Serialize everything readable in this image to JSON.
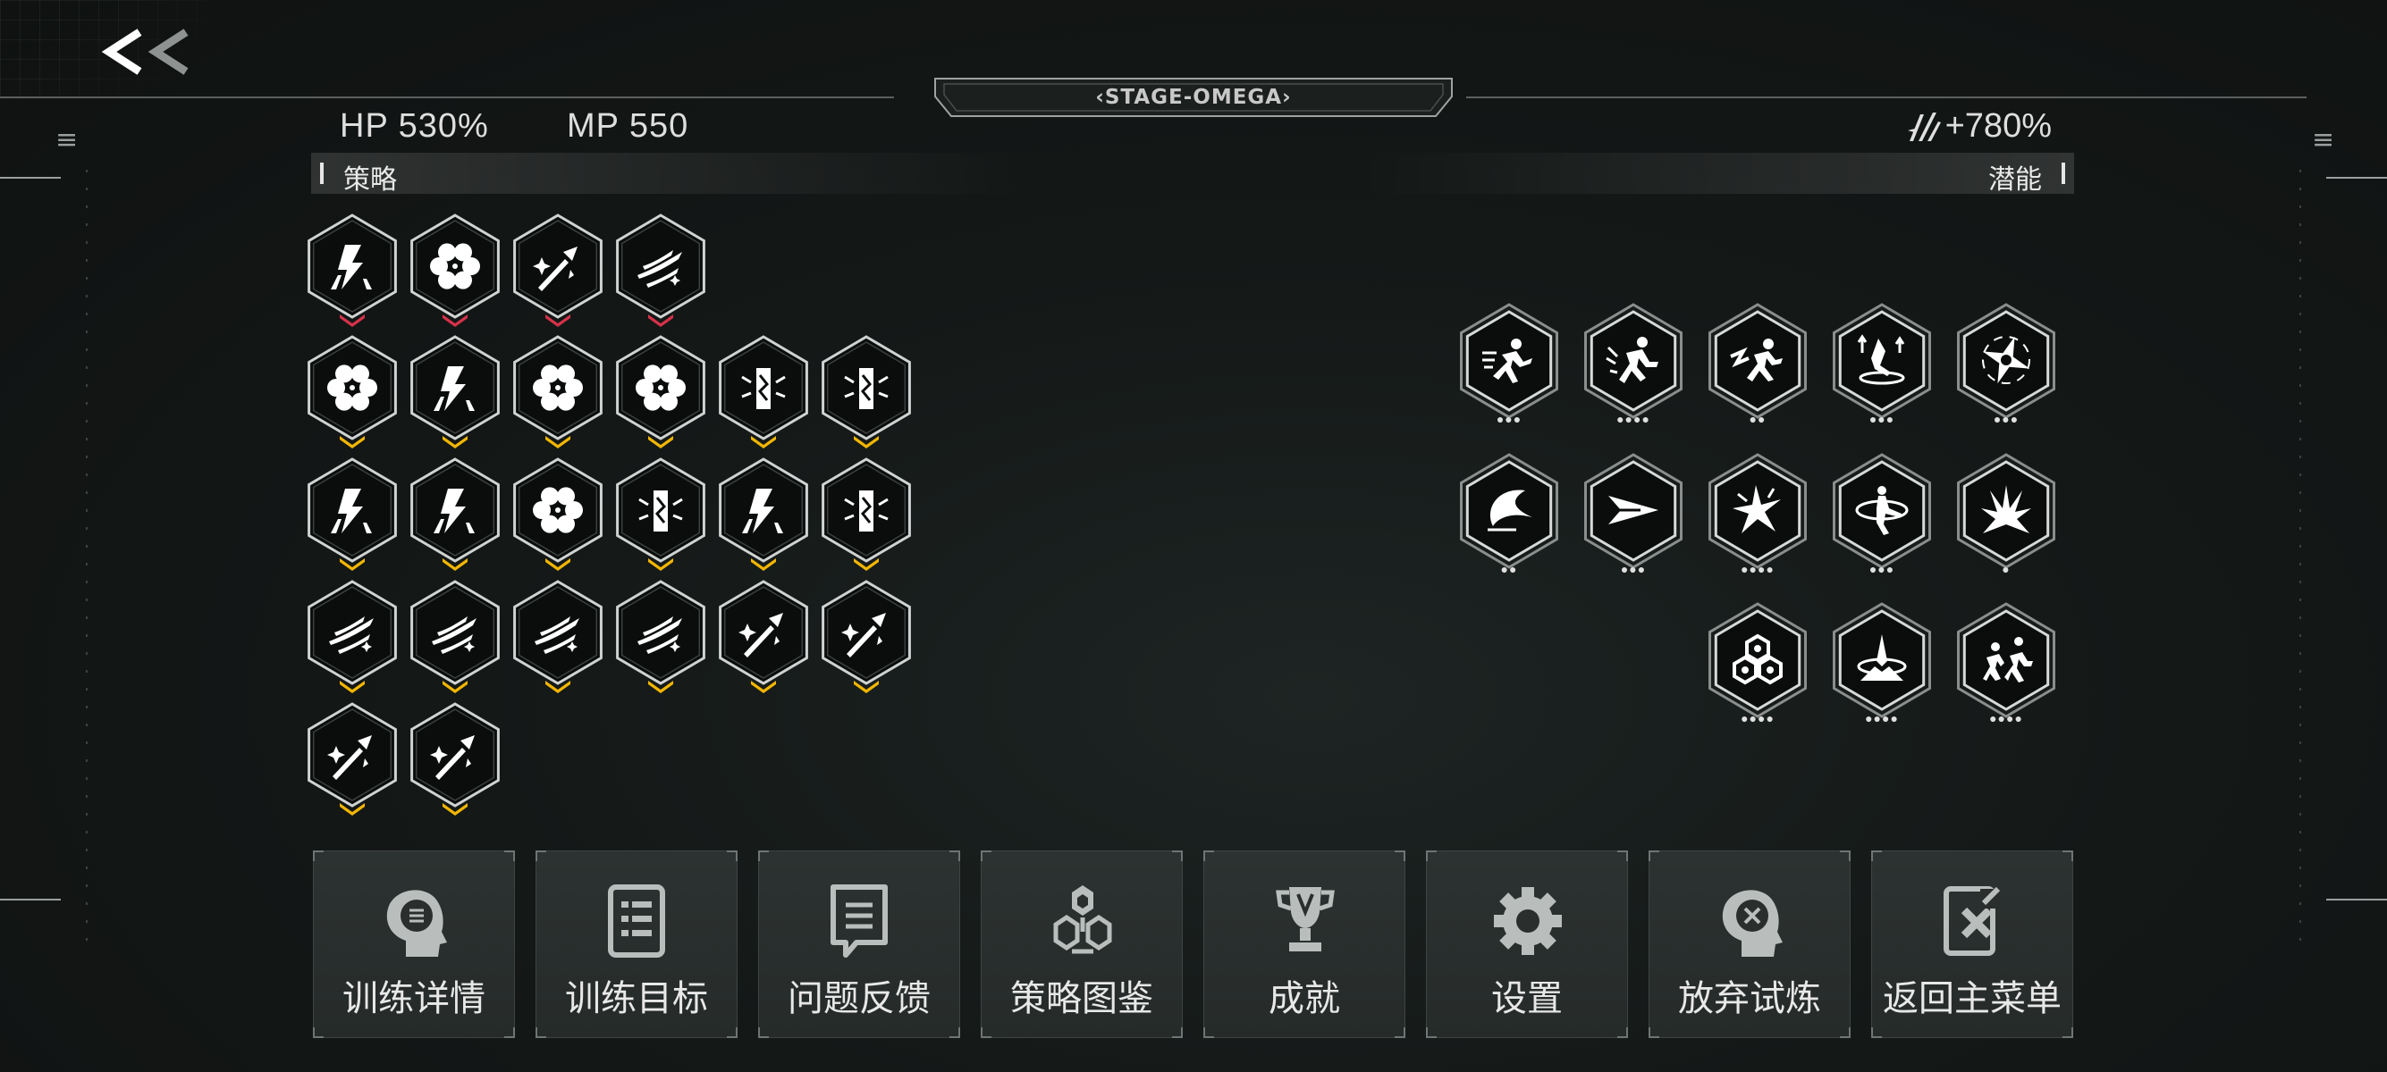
{
  "header": {
    "back_label": "back",
    "stage_title": "‹STAGE-OMEGA›",
    "hp": "HP 530%",
    "mp": "MP 550",
    "potential_bonus": "+780%"
  },
  "sections": {
    "strategy_label": "策略",
    "potential_label": "潜能"
  },
  "strategy_cards": [
    {
      "icon": "lightning-road-icon",
      "rank": "red"
    },
    {
      "icon": "flower-ring-icon",
      "rank": "red"
    },
    {
      "icon": "spear-sparkle-icon",
      "rank": "red"
    },
    {
      "icon": "dash-streak-icon",
      "rank": "red"
    },
    {
      "icon": "flower-ring-icon",
      "rank": "gold"
    },
    {
      "icon": "lightning-road-icon",
      "rank": "gold"
    },
    {
      "icon": "flower-ring-icon",
      "rank": "gold"
    },
    {
      "icon": "flower-ring-icon",
      "rank": "gold"
    },
    {
      "icon": "pillar-spark-icon",
      "rank": "gold"
    },
    {
      "icon": "pillar-spark-icon",
      "rank": "gold"
    },
    {
      "icon": "lightning-road-icon",
      "rank": "gold"
    },
    {
      "icon": "lightning-road-icon",
      "rank": "gold"
    },
    {
      "icon": "flower-ring-icon",
      "rank": "gold"
    },
    {
      "icon": "pillar-spark-icon",
      "rank": "gold"
    },
    {
      "icon": "lightning-road-icon",
      "rank": "gold"
    },
    {
      "icon": "pillar-spark-icon",
      "rank": "gold"
    },
    {
      "icon": "dash-streak-icon",
      "rank": "gold"
    },
    {
      "icon": "dash-streak-icon",
      "rank": "gold"
    },
    {
      "icon": "dash-streak-icon",
      "rank": "gold"
    },
    {
      "icon": "dash-streak-icon",
      "rank": "gold"
    },
    {
      "icon": "spear-sparkle-icon",
      "rank": "gold"
    },
    {
      "icon": "spear-sparkle-icon",
      "rank": "gold"
    },
    {
      "icon": "spear-sparkle-icon",
      "rank": "gold"
    },
    {
      "icon": "spear-sparkle-icon",
      "rank": "gold"
    }
  ],
  "potential_cards": [
    {
      "icon": "dash-runner-icon",
      "level": 3
    },
    {
      "icon": "sprint-runner-icon",
      "level": 4
    },
    {
      "icon": "speed-runner-icon",
      "level": 2
    },
    {
      "icon": "jump-kick-icon",
      "level": 3
    },
    {
      "icon": "shuriken-icon",
      "level": 3
    },
    {
      "icon": "crescent-slash-icon",
      "level": 2
    },
    {
      "icon": "arrow-dash-icon",
      "level": 3
    },
    {
      "icon": "shatter-icon",
      "level": 4
    },
    {
      "icon": "spin-kick-icon",
      "level": 3
    },
    {
      "icon": "burst-icon",
      "level": 1
    },
    {
      "icon": "hex-cluster-icon",
      "level": 4
    },
    {
      "icon": "impact-icon",
      "level": 4
    },
    {
      "icon": "multi-runner-icon",
      "level": 4
    }
  ],
  "menu": [
    {
      "icon": "training-detail-icon",
      "label": "训练详情"
    },
    {
      "icon": "document-list-icon",
      "label": "训练目标"
    },
    {
      "icon": "feedback-icon",
      "label": "问题反馈"
    },
    {
      "icon": "strategy-codex-icon",
      "label": "策略图鉴"
    },
    {
      "icon": "trophy-icon",
      "label": "成就"
    },
    {
      "icon": "gear-icon",
      "label": "设置"
    },
    {
      "icon": "abandon-icon",
      "label": "放弃试炼"
    },
    {
      "icon": "return-menu-icon",
      "label": "返回主菜单"
    }
  ],
  "colors": {
    "rank_red": "#d6324a",
    "rank_gold": "#f2b600",
    "hex_fill": "#0b0d0d",
    "hex_border": "#cfd3d2",
    "accent_text": "#e6e6e6"
  }
}
